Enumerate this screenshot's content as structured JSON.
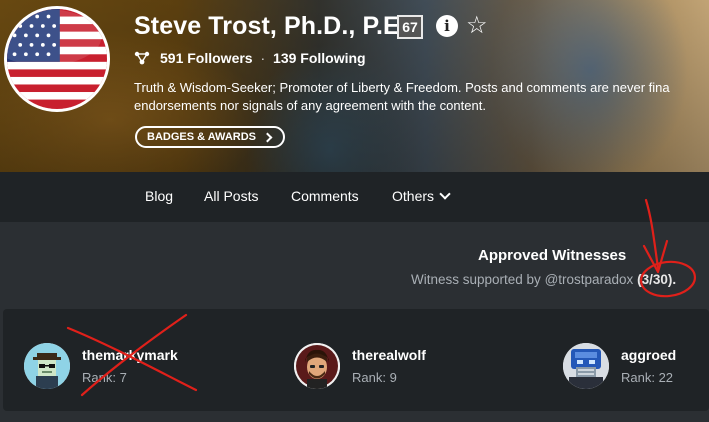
{
  "profile": {
    "name": "Steve Trost, Ph.D., P.E.",
    "reputation": "67",
    "followers_count": "591 Followers",
    "separator": "·",
    "following_count": "139 Following",
    "bio_line1": "Truth & Wisdom-Seeker; Promoter of Liberty & Freedom. Posts and comments are never fina",
    "bio_line2": "endorsements nor signals of any agreement with the content.",
    "badges_button": "BADGES & AWARDS",
    "icons": {
      "info": "info-icon",
      "favorite": "star-outline-icon",
      "followers": "followers-network-icon",
      "badges_chevron": "chevron-right-icon"
    }
  },
  "nav": {
    "items": [
      "Blog",
      "All Posts",
      "Comments",
      "Others"
    ],
    "others_icon": "chevron-down-icon"
  },
  "witnesses": {
    "title": "Approved Witnesses",
    "subtitle": "Witness supported by @trostparadox",
    "count": "(3/30).",
    "list": [
      {
        "name": "themarkymark",
        "rank": "Rank: 7"
      },
      {
        "name": "therealwolf",
        "rank": "Rank: 9"
      },
      {
        "name": "aggroed",
        "rank": "Rank: 22"
      }
    ]
  },
  "colors": {
    "page_bg": "#2b2f33",
    "panel_bg": "#1f2326",
    "muted_text": "#a9afb5",
    "annotation_red": "#e0201a"
  }
}
